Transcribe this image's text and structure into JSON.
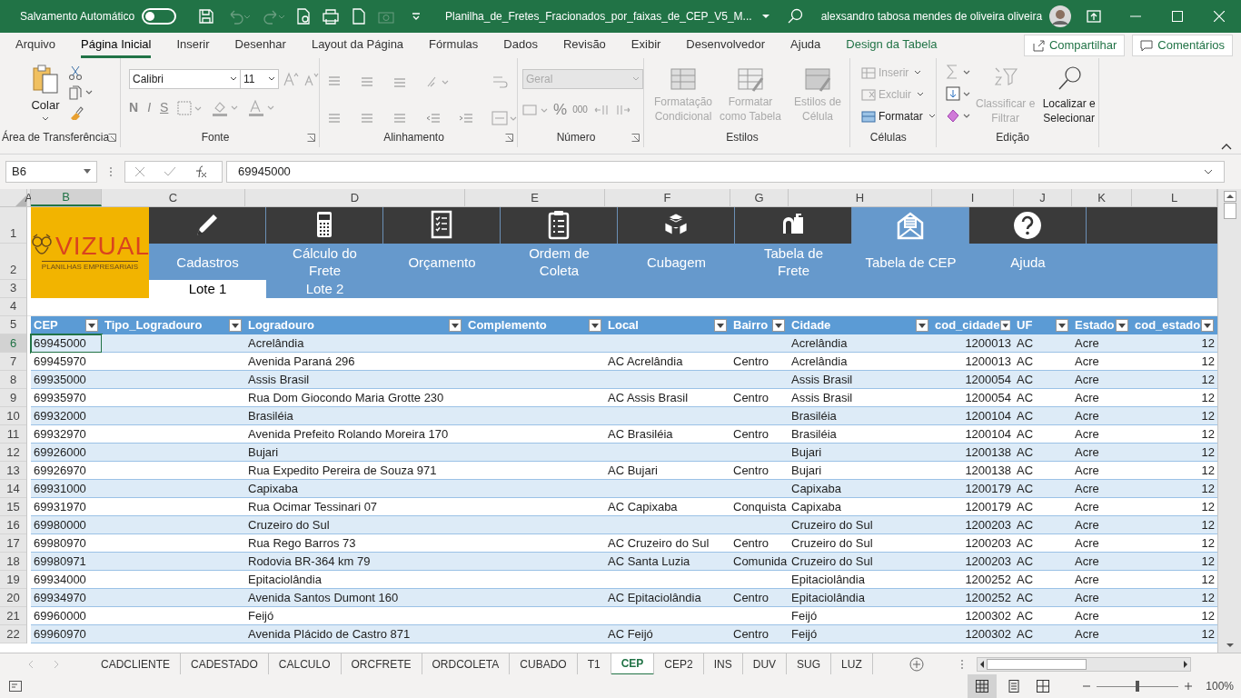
{
  "title_bar": {
    "autosave_label": "Salvamento Automático",
    "autosave_on": false,
    "file_name": "Planilha_de_Fretes_Fracionados_por_faixas_de_CEP_V5_M...",
    "user_name": "alexsandro tabosa mendes de oliveira oliveira"
  },
  "menu_tabs": [
    {
      "label": "Arquivo",
      "selected": false,
      "kind": "normal"
    },
    {
      "label": "Página Inicial",
      "selected": true,
      "kind": "normal"
    },
    {
      "label": "Inserir",
      "selected": false,
      "kind": "normal"
    },
    {
      "label": "Desenhar",
      "selected": false,
      "kind": "normal"
    },
    {
      "label": "Layout da Página",
      "selected": false,
      "kind": "normal"
    },
    {
      "label": "Fórmulas",
      "selected": false,
      "kind": "normal"
    },
    {
      "label": "Dados",
      "selected": false,
      "kind": "normal"
    },
    {
      "label": "Revisão",
      "selected": false,
      "kind": "normal"
    },
    {
      "label": "Exibir",
      "selected": false,
      "kind": "normal"
    },
    {
      "label": "Desenvolvedor",
      "selected": false,
      "kind": "normal"
    },
    {
      "label": "Ajuda",
      "selected": false,
      "kind": "normal"
    },
    {
      "label": "Design da Tabela",
      "selected": false,
      "kind": "contextual"
    }
  ],
  "share_button": "Compartilhar",
  "comments_button": "Comentários",
  "ribbon": {
    "clipboard": {
      "label": "Área de Transferência",
      "paste": "Colar"
    },
    "font": {
      "label": "Fonte",
      "name": "Calibri",
      "size": "11",
      "bold": "N",
      "italic": "I",
      "underline": "S"
    },
    "alignment": {
      "label": "Alinhamento"
    },
    "number": {
      "label": "Número",
      "format": "Geral",
      "format_disabled": true,
      "percent": "%",
      "thousands": "000"
    },
    "styles": {
      "label": "Estilos",
      "buttons": [
        {
          "label": "Formatação Condicional",
          "disabled": true
        },
        {
          "label": "Formatar como Tabela",
          "disabled": true
        },
        {
          "label": "Estilos de Célula",
          "disabled": true
        }
      ]
    },
    "cells": {
      "label": "Células",
      "buttons": [
        {
          "label": "Inserir",
          "disabled": true
        },
        {
          "label": "Excluir",
          "disabled": true
        },
        {
          "label": "Formatar",
          "disabled": false
        }
      ]
    },
    "editing": {
      "label": "Edição",
      "buttons": [
        {
          "label": "Classificar e Filtrar",
          "disabled": true
        },
        {
          "label": "Localizar e Selecionar",
          "disabled": false
        }
      ]
    }
  },
  "formula_bar": {
    "name_box": "B6",
    "value": "69945000"
  },
  "column_headers": [
    {
      "letter": "A",
      "selected": false
    },
    {
      "letter": "B",
      "selected": true
    },
    {
      "letter": "C",
      "selected": false
    },
    {
      "letter": "D",
      "selected": false
    },
    {
      "letter": "E",
      "selected": false
    },
    {
      "letter": "F",
      "selected": false
    },
    {
      "letter": "G",
      "selected": false
    },
    {
      "letter": "H",
      "selected": false
    },
    {
      "letter": "I",
      "selected": false
    },
    {
      "letter": "J",
      "selected": false
    },
    {
      "letter": "K",
      "selected": false
    },
    {
      "letter": "L",
      "selected": false
    }
  ],
  "logo": {
    "name": "VIZUAL",
    "tagline": "PLANILHAS EMPRESARIAIS"
  },
  "nav": [
    {
      "label": "Cadastros",
      "selected": false
    },
    {
      "label": "Cálculo do Frete",
      "selected": false
    },
    {
      "label": "Orçamento",
      "selected": false
    },
    {
      "label": "Ordem de Coleta",
      "selected": false
    },
    {
      "label": "Cubagem",
      "selected": false
    },
    {
      "label": "Tabela de Frete",
      "selected": false
    },
    {
      "label": "Tabela de CEP",
      "selected": true
    },
    {
      "label": "Ajuda",
      "selected": false
    }
  ],
  "lotes": [
    {
      "label": "Lote 1",
      "selected": true
    },
    {
      "label": "Lote 2",
      "selected": false
    }
  ],
  "top_row_numbers": [
    "1",
    "2",
    "3",
    "4",
    "5"
  ],
  "table": {
    "columns": [
      "CEP",
      "Tipo_Logradouro",
      "Logradouro",
      "Complemento",
      "Local",
      "Bairro",
      "Cidade",
      "cod_cidade",
      "UF",
      "Estado",
      "cod_estado"
    ],
    "rows": [
      {
        "number": "6",
        "selected": true,
        "cells": [
          "69945000",
          null,
          "Acrelândia",
          null,
          null,
          null,
          "Acrelândia",
          "1200013",
          "AC",
          "Acre",
          "12"
        ]
      },
      {
        "number": "7",
        "selected": false,
        "cells": [
          "69945970",
          null,
          "Avenida Paraná 296",
          null,
          "AC Acrelândia",
          "Centro",
          "Acrelândia",
          "1200013",
          "AC",
          "Acre",
          "12"
        ]
      },
      {
        "number": "8",
        "selected": false,
        "cells": [
          "69935000",
          null,
          "Assis Brasil",
          null,
          null,
          null,
          "Assis Brasil",
          "1200054",
          "AC",
          "Acre",
          "12"
        ]
      },
      {
        "number": "9",
        "selected": false,
        "cells": [
          "69935970",
          null,
          "Rua Dom Giocondo Maria Grotte 230",
          null,
          "AC Assis Brasil",
          "Centro",
          "Assis Brasil",
          "1200054",
          "AC",
          "Acre",
          "12"
        ]
      },
      {
        "number": "10",
        "selected": false,
        "cells": [
          "69932000",
          null,
          "Brasiléia",
          null,
          null,
          null,
          "Brasiléia",
          "1200104",
          "AC",
          "Acre",
          "12"
        ]
      },
      {
        "number": "11",
        "selected": false,
        "cells": [
          "69932970",
          null,
          "Avenida Prefeito Rolando Moreira 170",
          null,
          "AC Brasiléia",
          "Centro",
          "Brasiléia",
          "1200104",
          "AC",
          "Acre",
          "12"
        ]
      },
      {
        "number": "12",
        "selected": false,
        "cells": [
          "69926000",
          null,
          "Bujari",
          null,
          null,
          null,
          "Bujari",
          "1200138",
          "AC",
          "Acre",
          "12"
        ]
      },
      {
        "number": "13",
        "selected": false,
        "cells": [
          "69926970",
          null,
          "Rua Expedito Pereira de Souza 971",
          null,
          "AC Bujari",
          "Centro",
          "Bujari",
          "1200138",
          "AC",
          "Acre",
          "12"
        ]
      },
      {
        "number": "14",
        "selected": false,
        "cells": [
          "69931000",
          null,
          "Capixaba",
          null,
          null,
          null,
          "Capixaba",
          "1200179",
          "AC",
          "Acre",
          "12"
        ]
      },
      {
        "number": "15",
        "selected": false,
        "cells": [
          "69931970",
          null,
          "Rua Ocimar Tessinari 07",
          null,
          "AC Capixaba",
          "Conquista",
          "Capixaba",
          "1200179",
          "AC",
          "Acre",
          "12"
        ]
      },
      {
        "number": "16",
        "selected": false,
        "cells": [
          "69980000",
          null,
          "Cruzeiro do Sul",
          null,
          null,
          null,
          "Cruzeiro do Sul",
          "1200203",
          "AC",
          "Acre",
          "12"
        ]
      },
      {
        "number": "17",
        "selected": false,
        "cells": [
          "69980970",
          null,
          "Rua Rego Barros 73",
          null,
          "AC Cruzeiro do Sul",
          "Centro",
          "Cruzeiro do Sul",
          "1200203",
          "AC",
          "Acre",
          "12"
        ]
      },
      {
        "number": "18",
        "selected": false,
        "cells": [
          "69980971",
          null,
          "Rodovia BR-364 km 79",
          null,
          "AC Santa Luzia",
          "Comunida",
          "Cruzeiro do Sul",
          "1200203",
          "AC",
          "Acre",
          "12"
        ]
      },
      {
        "number": "19",
        "selected": false,
        "cells": [
          "69934000",
          null,
          "Epitaciolândia",
          null,
          null,
          null,
          "Epitaciolândia",
          "1200252",
          "AC",
          "Acre",
          "12"
        ]
      },
      {
        "number": "20",
        "selected": false,
        "cells": [
          "69934970",
          null,
          "Avenida Santos Dumont 160",
          null,
          "AC Epitaciolândia",
          "Centro",
          "Epitaciolândia",
          "1200252",
          "AC",
          "Acre",
          "12"
        ]
      },
      {
        "number": "21",
        "selected": false,
        "cells": [
          "69960000",
          null,
          "Feijó",
          null,
          null,
          null,
          "Feijó",
          "1200302",
          "AC",
          "Acre",
          "12"
        ]
      },
      {
        "number": "22",
        "selected": false,
        "cells": [
          "69960970",
          null,
          "Avenida Plácido de Castro 871",
          null,
          "AC Feijó",
          "Centro",
          "Feijó",
          "1200302",
          "AC",
          "Acre",
          "12"
        ]
      }
    ]
  },
  "sheet_tabs": [
    {
      "label": "CADCLIENTE",
      "selected": false
    },
    {
      "label": "CADESTADO",
      "selected": false
    },
    {
      "label": "CALCULO",
      "selected": false
    },
    {
      "label": "ORCFRETE",
      "selected": false
    },
    {
      "label": "ORDCOLETA",
      "selected": false
    },
    {
      "label": "CUBADO",
      "selected": false
    },
    {
      "label": "T1",
      "selected": false
    },
    {
      "label": "CEP",
      "selected": true
    },
    {
      "label": "CEP2",
      "selected": false
    },
    {
      "label": "INS",
      "selected": false
    },
    {
      "label": "DUV",
      "selected": false
    },
    {
      "label": "SUG",
      "selected": false
    },
    {
      "label": "LUZ",
      "selected": false
    }
  ],
  "status_bar": {
    "zoom": "100%",
    "zoom_slider": {
      "level": 0.5
    }
  }
}
